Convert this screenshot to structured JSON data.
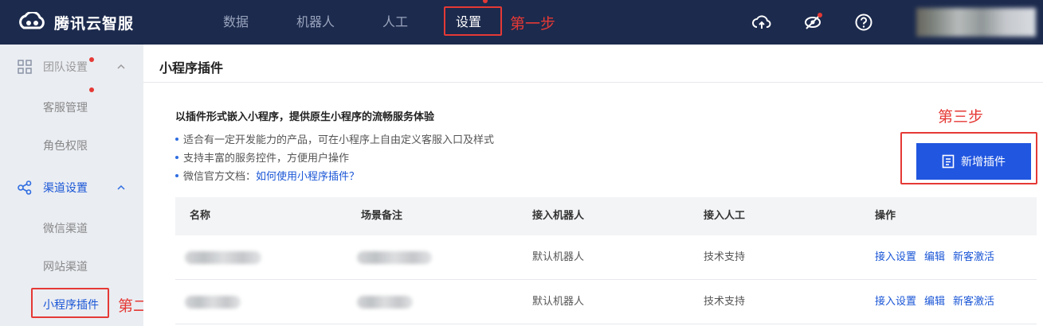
{
  "header": {
    "logo_text": "腾讯云智服",
    "nav": [
      {
        "label": "数据"
      },
      {
        "label": "机器人"
      },
      {
        "label": "人工"
      },
      {
        "label": "设置"
      }
    ],
    "step1_label": "第一步"
  },
  "sidebar": {
    "groups": [
      {
        "label": "团队设置",
        "items": [
          {
            "label": "客服管理"
          },
          {
            "label": "角色权限"
          }
        ]
      },
      {
        "label": "渠道设置",
        "items": [
          {
            "label": "微信渠道"
          },
          {
            "label": "网站渠道"
          },
          {
            "label": "小程序插件"
          }
        ]
      }
    ],
    "step2_label": "第二步"
  },
  "main": {
    "page_title": "小程序插件",
    "intro_title": "以插件形式嵌入小程序，提供原生小程序的流畅服务体验",
    "bullets": [
      "适合有一定开发能力的产品，可在小程序上自由定义客服入口及样式",
      "支持丰富的服务控件，方便用户操作"
    ],
    "doc_prefix": "微信官方文档：",
    "doc_link": "如何使用小程序插件？",
    "step3_label": "第三步",
    "add_button_label": "新增插件"
  },
  "table": {
    "columns": [
      "名称",
      "场景备注",
      "接入机器人",
      "接入人工",
      "操作"
    ],
    "rows": [
      {
        "robot": "默认机器人",
        "agent": "技术支持",
        "actions": [
          "接入设置",
          "编辑",
          "新客激活"
        ]
      },
      {
        "robot": "默认机器人",
        "agent": "技术支持",
        "actions": [
          "接入设置",
          "编辑",
          "新客激活"
        ]
      }
    ]
  },
  "colors": {
    "header_bg": "#1c2a4d",
    "accent": "#2156e0",
    "annotation_red": "#e53935",
    "sidebar_bg": "#eaedf2"
  },
  "icons": [
    "cloud-upload-icon",
    "eye-off-icon",
    "help-icon",
    "document-icon",
    "grid-icon",
    "share-nodes-icon",
    "chevron-up-icon"
  ]
}
